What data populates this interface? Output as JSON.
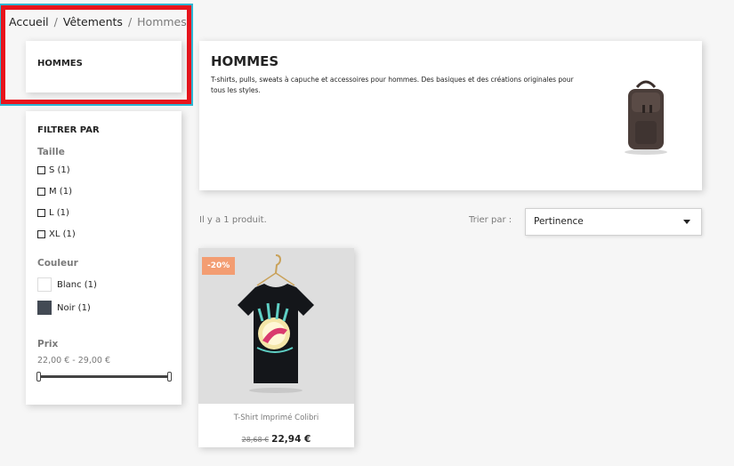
{
  "breadcrumb": {
    "items": [
      "Accueil",
      "Vêtements",
      "Hommes"
    ],
    "separator": "/"
  },
  "category_card": {
    "title": "HOMMES"
  },
  "filters": {
    "title": "FILTRER PAR",
    "size": {
      "title": "Taille",
      "options": [
        "S (1)",
        "M (1)",
        "L (1)",
        "XL (1)"
      ]
    },
    "color": {
      "title": "Couleur",
      "options": [
        {
          "label": "Blanc (1)",
          "color": "#ffffff"
        },
        {
          "label": "Noir (1)",
          "color": "#434a54"
        }
      ]
    },
    "price": {
      "title": "Prix",
      "range": "22,00 € - 29,00 €"
    }
  },
  "header": {
    "title": "HOMMES",
    "description": "T-shirts, pulls, sweats à capuche et accessoires pour hommes. Des basiques et des créations originales pour tous les styles.",
    "image_icon": "backpack-image"
  },
  "listing": {
    "count": "Il y a 1 produit.",
    "sort_label": "Trier par :",
    "sort_value": "Pertinence"
  },
  "product": {
    "discount": "-20%",
    "name": "T-Shirt Imprimé Colibri",
    "old_price": "28,68 €",
    "price": "22,94 €",
    "image_icon": "hummingbird-tshirt-image"
  },
  "colors": {
    "highlight_red": "#e8141c",
    "highlight_blue": "#2fb5d2",
    "discount_bg": "#f39d72"
  }
}
